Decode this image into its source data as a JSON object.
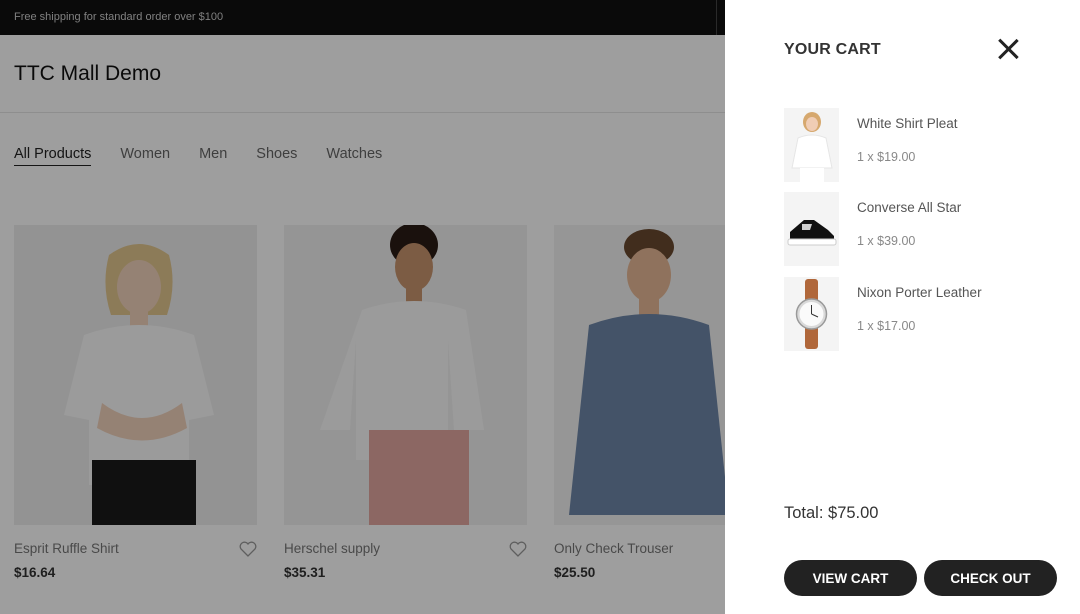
{
  "announcement": "Free shipping for standard order over $100",
  "site": {
    "logo": "TTC Mall Demo"
  },
  "filters": [
    {
      "label": "All Products",
      "active": true
    },
    {
      "label": "Women",
      "active": false
    },
    {
      "label": "Men",
      "active": false
    },
    {
      "label": "Shoes",
      "active": false
    },
    {
      "label": "Watches",
      "active": false
    }
  ],
  "products": [
    {
      "name": "Esprit Ruffle Shirt",
      "price": "$16.64"
    },
    {
      "name": "Herschel supply",
      "price": "$35.31"
    },
    {
      "name": "Only Check Trouser",
      "price": "$25.50"
    }
  ],
  "cart": {
    "title": "YOUR CART",
    "items": [
      {
        "name": "White Shirt Pleat",
        "qty_price": "1 x $19.00",
        "thumb_icon": "shirt-woman-thumbnail"
      },
      {
        "name": "Converse All Star",
        "qty_price": "1 x $39.00",
        "thumb_icon": "sneaker-thumbnail"
      },
      {
        "name": "Nixon Porter Leather",
        "qty_price": "1 x $17.00",
        "thumb_icon": "watch-thumbnail"
      }
    ],
    "total": "Total: $75.00",
    "view_cart_label": "VIEW CART",
    "checkout_label": "CHECK OUT"
  },
  "colors": {
    "topbar": "#111111",
    "button": "#222222",
    "overlay": "rgba(0,0,0,0.38)"
  }
}
